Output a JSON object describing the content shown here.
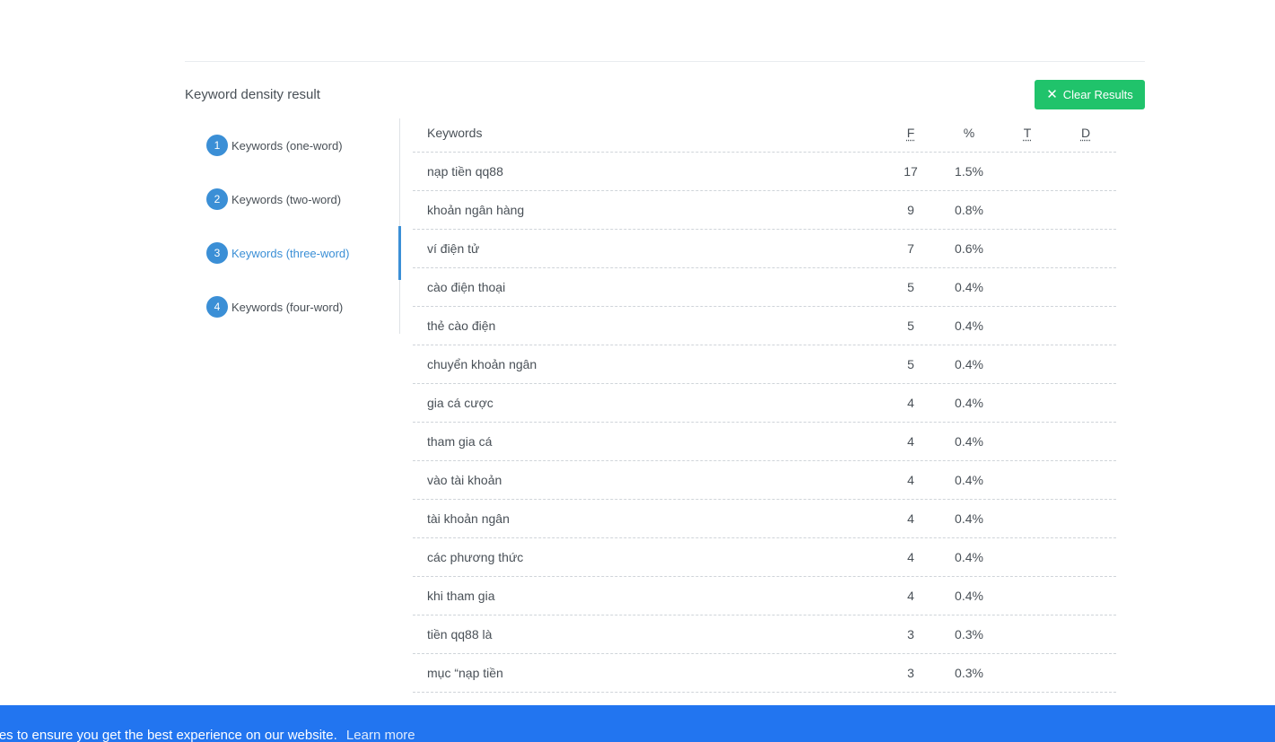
{
  "result": {
    "title": "Keyword density result",
    "clear_label": "Clear Results"
  },
  "tabs": [
    {
      "num": "1",
      "label": "Keywords (one-word)",
      "active": false
    },
    {
      "num": "2",
      "label": "Keywords (two-word)",
      "active": false
    },
    {
      "num": "3",
      "label": "Keywords (three-word)",
      "active": true
    },
    {
      "num": "4",
      "label": "Keywords (four-word)",
      "active": false
    }
  ],
  "table": {
    "headers": {
      "keyword": "Keywords",
      "f": "F",
      "pct": "%",
      "t": "T",
      "d": "D"
    },
    "rows": [
      {
        "keyword": "nạp tiền qq88",
        "f": "17",
        "pct": "1.5%"
      },
      {
        "keyword": "khoản ngân hàng",
        "f": "9",
        "pct": "0.8%"
      },
      {
        "keyword": "ví điện tử",
        "f": "7",
        "pct": "0.6%"
      },
      {
        "keyword": "cào điện thoại",
        "f": "5",
        "pct": "0.4%"
      },
      {
        "keyword": "thẻ cào điện",
        "f": "5",
        "pct": "0.4%"
      },
      {
        "keyword": "chuyển khoản ngân",
        "f": "5",
        "pct": "0.4%"
      },
      {
        "keyword": "gia cá cược",
        "f": "4",
        "pct": "0.4%"
      },
      {
        "keyword": "tham gia cá",
        "f": "4",
        "pct": "0.4%"
      },
      {
        "keyword": "vào tài khoản",
        "f": "4",
        "pct": "0.4%"
      },
      {
        "keyword": "tài khoản ngân",
        "f": "4",
        "pct": "0.4%"
      },
      {
        "keyword": "các phương thức",
        "f": "4",
        "pct": "0.4%"
      },
      {
        "keyword": "khi tham gia",
        "f": "4",
        "pct": "0.4%"
      },
      {
        "keyword": "tiền qq88 là",
        "f": "3",
        "pct": "0.3%"
      },
      {
        "keyword": "mục “nạp tiền",
        "f": "3",
        "pct": "0.3%"
      }
    ]
  },
  "cookie": {
    "text": "kies to ensure you get the best experience on our website.",
    "learn_more": "Learn more"
  },
  "colors": {
    "accent": "#3b8fd6",
    "clear_button": "#20c36b",
    "cookie_bar": "#2275f0"
  }
}
